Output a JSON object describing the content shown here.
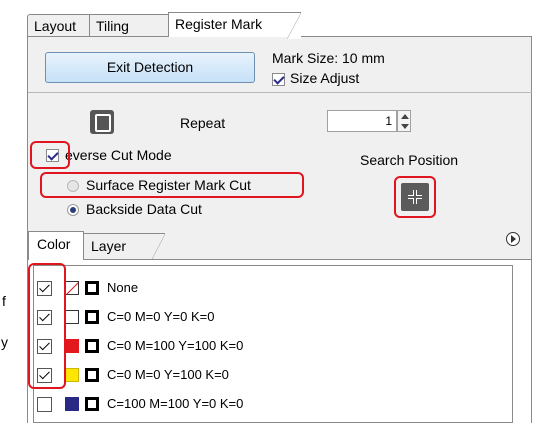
{
  "tabs": [
    {
      "label": "Layout"
    },
    {
      "label": "Tiling"
    },
    {
      "label": "Register Mark"
    }
  ],
  "register": {
    "exit_button": "Exit Detection",
    "mark_size": "Mark Size:  10 mm",
    "size_adjust": "Size Adjust",
    "repeat_label": "Repeat",
    "repeat_value": "1",
    "reverse_cut_mode": "everse Cut Mode",
    "search_position": "Search Position",
    "surface_register_mark_cut": "Surface Register Mark Cut",
    "backside_data_cut": "Backside Data Cut"
  },
  "lower_tabs": [
    {
      "label": "Color"
    },
    {
      "label": "Layer"
    }
  ],
  "color_rows": [
    {
      "label": "None",
      "checked": true,
      "color": "none"
    },
    {
      "label": "C=0 M=0 Y=0 K=0",
      "checked": true,
      "color": "#ffffff"
    },
    {
      "label": "C=0 M=100 Y=100 K=0",
      "checked": true,
      "color": "#e3171e"
    },
    {
      "label": "C=0 M=0 Y=100 K=0",
      "checked": true,
      "color": "#ffe600"
    },
    {
      "label": "C=100 M=100 Y=0 K=0",
      "checked": false,
      "color": "#2a2a86"
    }
  ],
  "side_fragments": [
    "f",
    "y"
  ],
  "colors": {
    "highlight": "#e0151f",
    "button_blue": "#c6e1f7",
    "panel_bg": "#f0f0f0"
  }
}
